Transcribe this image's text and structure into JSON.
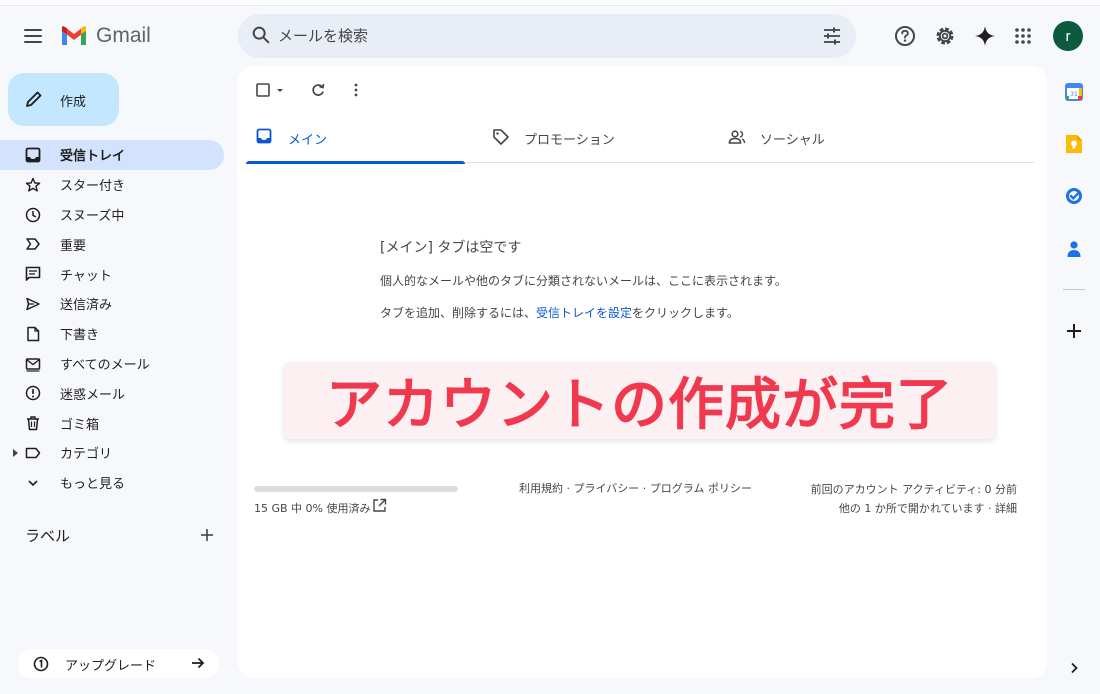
{
  "header": {
    "app_name": "Gmail",
    "search_placeholder": "メールを検索",
    "avatar_initial": "r",
    "icons": [
      "menu-icon",
      "search-icon",
      "tune-icon",
      "help-icon",
      "settings-icon",
      "gemini-icon",
      "apps-icon"
    ]
  },
  "compose": {
    "label": "作成"
  },
  "sidebar": {
    "items": [
      {
        "label": "受信トレイ",
        "icon": "inbox-icon",
        "active": true
      },
      {
        "label": "スター付き",
        "icon": "star-icon"
      },
      {
        "label": "スヌーズ中",
        "icon": "clock-icon"
      },
      {
        "label": "重要",
        "icon": "important-icon"
      },
      {
        "label": "チャット",
        "icon": "chat-icon"
      },
      {
        "label": "送信済み",
        "icon": "send-icon"
      },
      {
        "label": "下書き",
        "icon": "draft-icon"
      },
      {
        "label": "すべてのメール",
        "icon": "all-mail-icon"
      },
      {
        "label": "迷惑メール",
        "icon": "spam-icon"
      },
      {
        "label": "ゴミ箱",
        "icon": "trash-icon"
      },
      {
        "label": "カテゴリ",
        "icon": "label-icon"
      },
      {
        "label": "もっと見る",
        "icon": "chevron-down-icon"
      }
    ],
    "labels_heading": "ラベル",
    "upgrade_label": "アップグレード"
  },
  "main": {
    "tabs": [
      {
        "label": "メイン",
        "icon": "inbox-icon",
        "active": true
      },
      {
        "label": "プロモーション",
        "icon": "tag-icon"
      },
      {
        "label": "ソーシャル",
        "icon": "people-icon"
      }
    ],
    "empty_title": "[メイン] タブは空です",
    "empty_desc": "個人的なメールや他のタブに分類されないメールは、ここに表示されます。",
    "empty_hint_before": "タブを追加、削除するには、",
    "empty_hint_link": "受信トレイを設定",
    "empty_hint_after": "をクリックします。",
    "banner_text": "アカウントの作成が完了",
    "storage_text": "15 GB 中 0% 使用済み",
    "storage_percent": 0,
    "footer_links": "利用規約 · プライバシー · プログラム ポリシー",
    "activity_line1": "前回のアカウント アクティビティ: 0 分前",
    "activity_line2_prefix": "他の 1 か所で開かれています · ",
    "activity_detail": "詳細"
  },
  "right_rail": [
    "calendar-icon",
    "keep-icon",
    "tasks-icon",
    "contacts-icon",
    "add-icon",
    "chevron-right-icon"
  ],
  "colors": {
    "accent": "#0b57d0",
    "compose_bg": "#c2e7ff",
    "active_nav_bg": "#d3e3fd",
    "banner_text": "#f0394e",
    "avatar_bg": "#0d5b3e"
  }
}
